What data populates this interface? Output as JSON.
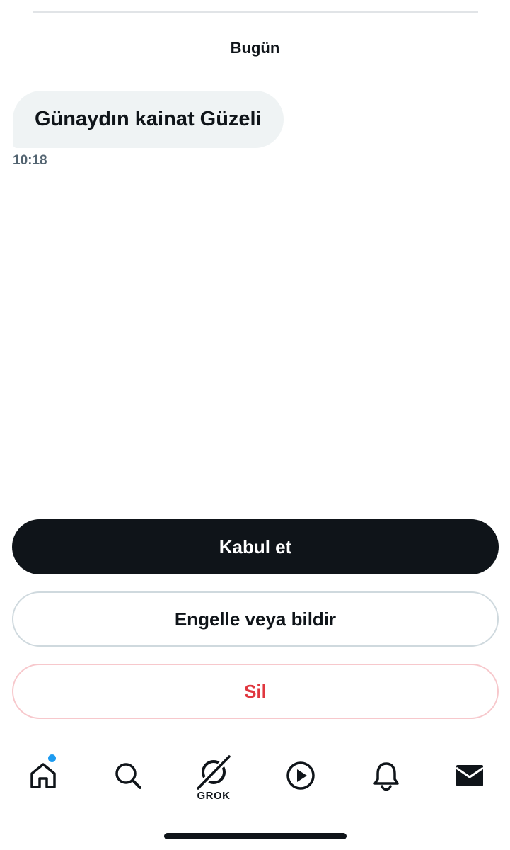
{
  "conversation": {
    "date_label": "Bugün",
    "messages": [
      {
        "text": "Günaydın kainat Güzeli",
        "time": "10:18"
      }
    ]
  },
  "actions": {
    "accept_label": "Kabul et",
    "block_report_label": "Engelle veya bildir",
    "delete_label": "Sil"
  },
  "tabbar": {
    "items": [
      {
        "icon": "home-icon",
        "has_notification": true
      },
      {
        "icon": "search-icon"
      },
      {
        "icon": "grok-icon",
        "label": "GROK"
      },
      {
        "icon": "play-icon"
      },
      {
        "icon": "bell-icon"
      },
      {
        "icon": "mail-icon",
        "active": true
      }
    ]
  },
  "colors": {
    "primary_text": "#0f1419",
    "secondary_text": "#536471",
    "bubble": "#eff3f4",
    "danger": "#e0373f",
    "notification": "#1d9bf0"
  }
}
